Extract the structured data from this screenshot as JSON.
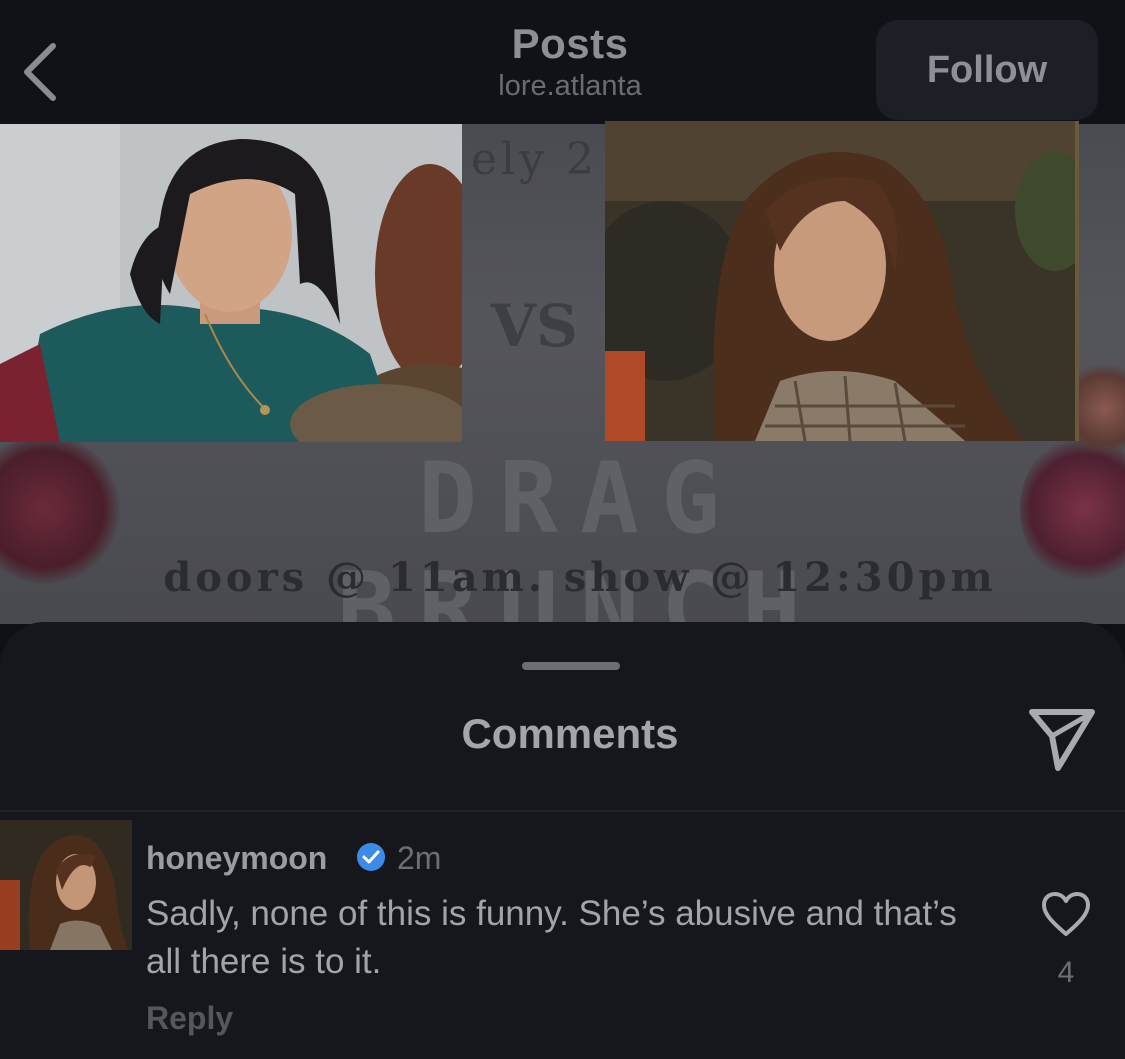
{
  "header": {
    "title": "Posts",
    "username": "lore.atlanta",
    "follow_label": "Follow",
    "back_icon": "chevron-left-icon"
  },
  "post": {
    "poster_top_text": "ely 2",
    "poster_vs": "VS",
    "poster_headline": "DRAG BRUNCH",
    "poster_subtext": "doors @ 11am. show @ 12:30pm",
    "photo_left": "photo-girl-teal-jacket",
    "photo_right": "photo-woman-plaid-jacket"
  },
  "comments_sheet": {
    "title": "Comments",
    "share_icon": "send-icon",
    "comments": [
      {
        "username": "honeymoon",
        "verified": true,
        "time": "2m",
        "text": "Sadly, none of this is funny. She’s abusive and that’s all there is to it.",
        "reply_label": "Reply",
        "like_count": "4"
      }
    ]
  },
  "colors": {
    "background": "#0f1014",
    "sheet": "#15171c",
    "verified_badge": "#3d8be8"
  }
}
